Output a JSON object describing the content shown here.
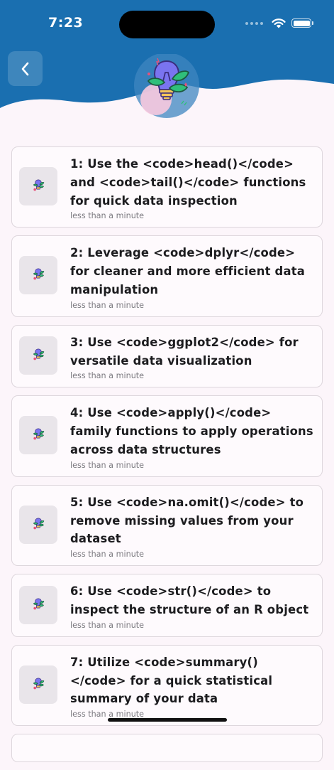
{
  "status_bar": {
    "time": "7:23"
  },
  "header": {
    "back_icon": "chevron-left-icon",
    "hero_icon": "lightbulb-plant-icon"
  },
  "tips": [
    {
      "title": "1: Use the <code>head()</code> and <code>tail()</code> functions for quick data inspection",
      "meta": "less than a minute"
    },
    {
      "title": "2: Leverage <code>dplyr</code> for cleaner and more efficient data manipulation",
      "meta": "less than a minute"
    },
    {
      "title": "3: Use <code>ggplot2</code> for versatile data visualization",
      "meta": "less than a minute"
    },
    {
      "title": "4: Use <code>apply()</code> family functions to apply operations across data structures",
      "meta": "less than a minute"
    },
    {
      "title": "5: Use <code>na.omit()</code> to remove missing values from your dataset",
      "meta": "less than a minute"
    },
    {
      "title": "6: Use <code>str()</code> to inspect the structure of an R object",
      "meta": "less than a minute"
    },
    {
      "title": "7: Utilize <code>summary()</code> for a quick statistical summary of your data",
      "meta": "less than a minute"
    }
  ],
  "colors": {
    "header_blue": "#1a6fb0",
    "background": "#fcf5fa"
  }
}
